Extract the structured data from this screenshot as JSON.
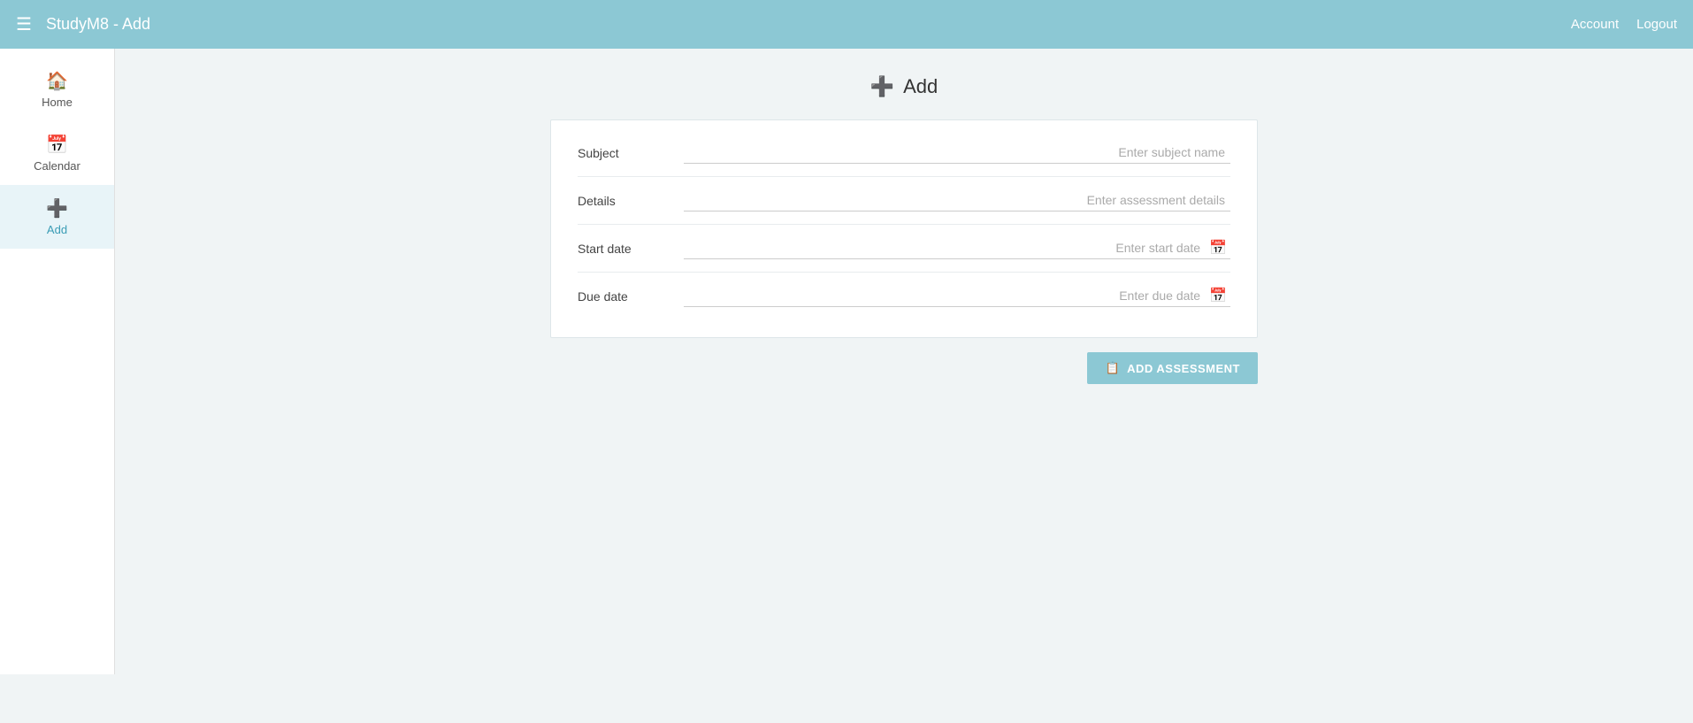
{
  "topnav": {
    "menu_icon": "☰",
    "title": "StudyM8 - Add",
    "account_label": "Account",
    "logout_label": "Logout"
  },
  "sidebar": {
    "items": [
      {
        "id": "home",
        "label": "Home",
        "icon": "🏠",
        "active": false
      },
      {
        "id": "calendar",
        "label": "Calendar",
        "icon": "📅",
        "active": false
      },
      {
        "id": "add",
        "label": "Add",
        "icon": "➕",
        "active": true
      }
    ]
  },
  "page": {
    "title": "Add",
    "title_icon": "➕"
  },
  "form": {
    "fields": [
      {
        "id": "subject",
        "label": "Subject",
        "placeholder": "Enter subject name",
        "type": "text"
      },
      {
        "id": "details",
        "label": "Details",
        "placeholder": "Enter assessment details",
        "type": "text"
      },
      {
        "id": "start_date",
        "label": "Start date",
        "placeholder": "Enter start date",
        "type": "date"
      },
      {
        "id": "due_date",
        "label": "Due date",
        "placeholder": "Enter due date",
        "type": "date"
      }
    ],
    "submit_label": "ADD ASSESSMENT",
    "submit_icon": "📋"
  }
}
